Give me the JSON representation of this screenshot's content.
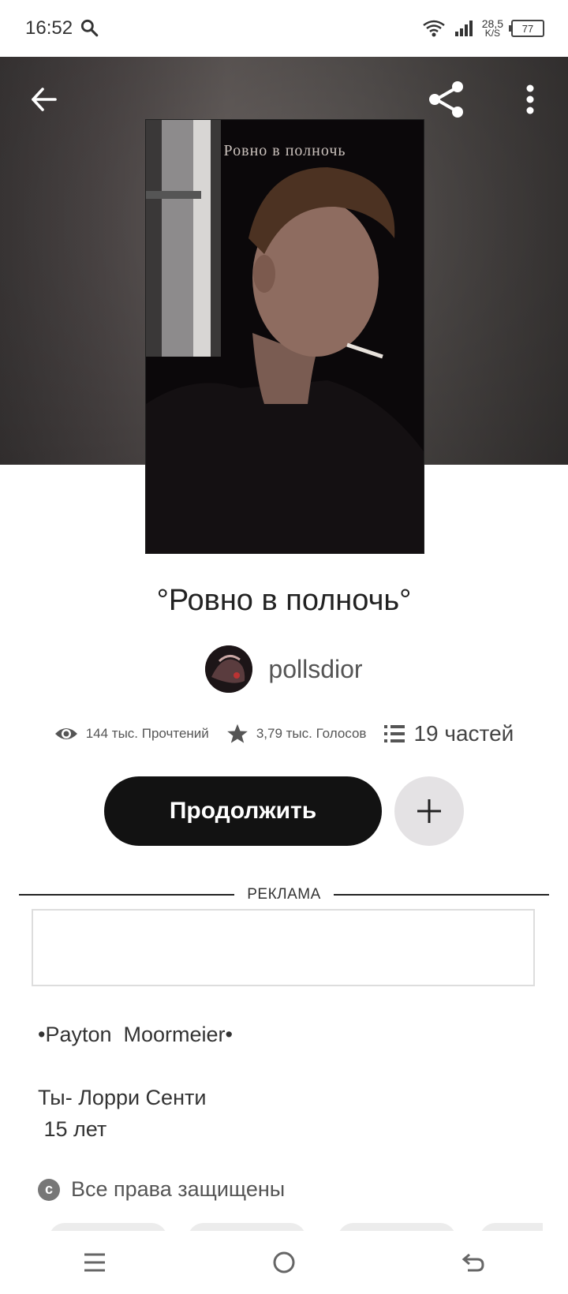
{
  "status_bar": {
    "time": "16:52",
    "net_speed_value": "28,5",
    "net_speed_unit": "K/S",
    "battery": "77"
  },
  "toolbar": {
    "back_icon": "arrow-left-icon",
    "share_icon": "share-icon",
    "more_icon": "more-vertical-icon"
  },
  "cover": {
    "title": "Ровно в полночь"
  },
  "story": {
    "title": "°Ровно в полночь°",
    "author": "pollsdior",
    "reads": "144 тыс. Прочтений",
    "votes": "3,79 тыс. Голосов",
    "parts": "19 частей"
  },
  "actions": {
    "continue_label": "Продолжить",
    "add_icon": "plus-icon"
  },
  "ad": {
    "label": "РЕКЛАМА"
  },
  "description": {
    "line1": "•Payton  Moormeier•",
    "line2": "Ты- Лорри Сенти",
    "line3": " 15 лет"
  },
  "copyright": {
    "text": "Все права защищены",
    "icon": "c"
  },
  "colors": {
    "button_dark": "#121212",
    "add_bg": "#e4e2e4",
    "text": "#222222"
  }
}
